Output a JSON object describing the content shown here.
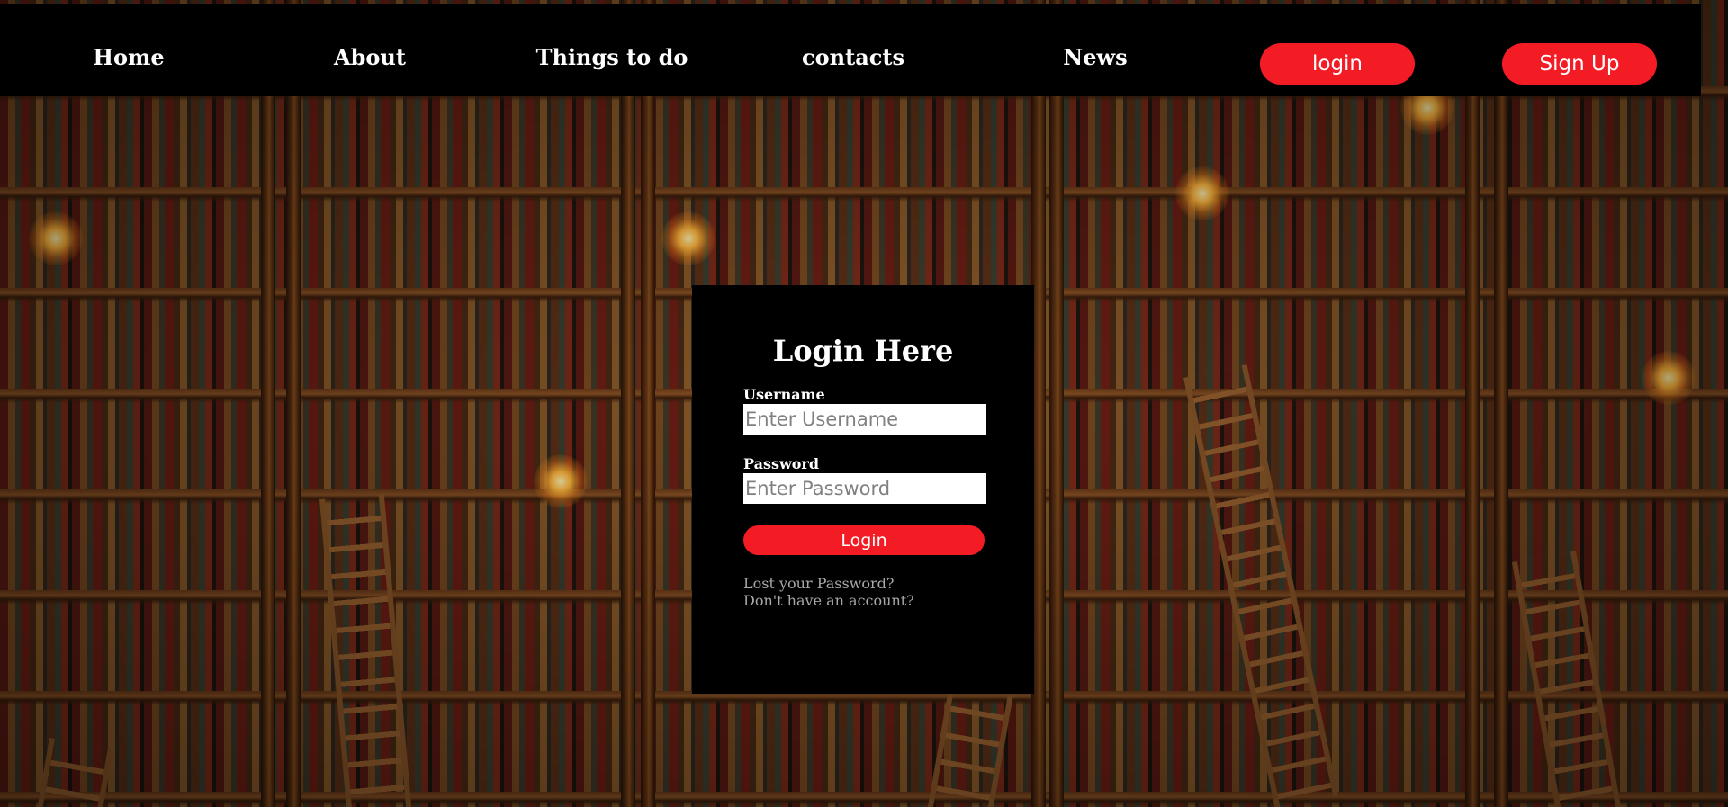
{
  "nav": {
    "links": [
      "Home",
      "About",
      "Things to do",
      "contacts",
      "News"
    ],
    "login_label": "login",
    "signup_label": "Sign Up"
  },
  "login_form": {
    "title": "Login Here",
    "username_label": "Username",
    "username_placeholder": "Enter Username",
    "password_label": "Password",
    "password_placeholder": "Enter Password",
    "submit_label": "Login",
    "lost_password_text": "Lost your Password?",
    "no_account_text": "Don't have an account?"
  },
  "colors": {
    "accent": "#f31c24",
    "nav_background": "#000000",
    "panel_background": "#000000",
    "link_muted": "#a8a8a8"
  }
}
